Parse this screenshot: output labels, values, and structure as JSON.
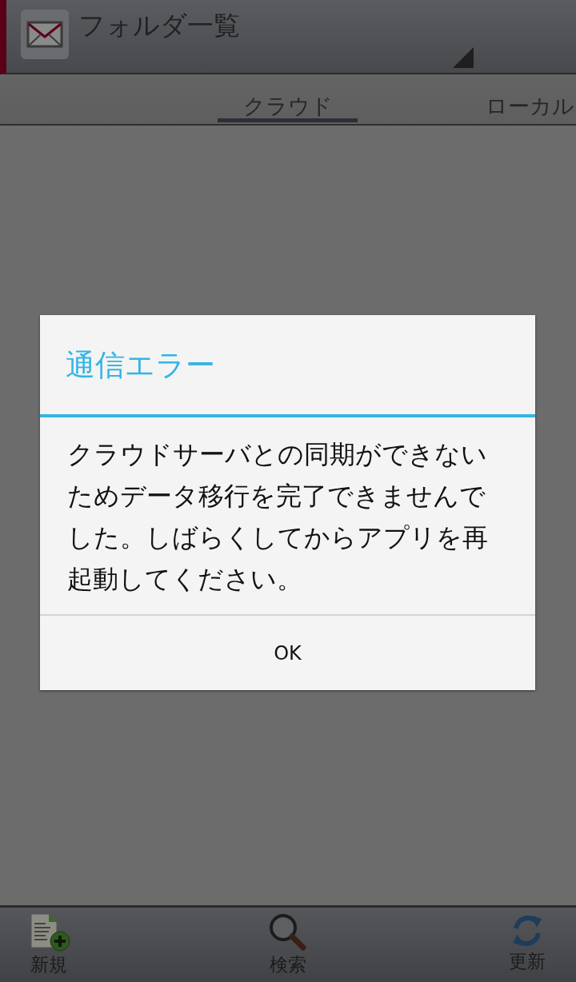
{
  "header": {
    "title": "フォルダ一覧"
  },
  "tabs": [
    {
      "label": "クラウド",
      "selected": true
    },
    {
      "label": "ローカル",
      "selected": false
    }
  ],
  "dialog": {
    "title": "通信エラー",
    "message": "クラウドサーバとの同期ができないためデータ移行を完了できませんでした。しばらくしてからアプリを再起動してください。",
    "button": "OK"
  },
  "toolbar": [
    {
      "kind": "new",
      "label": "新規"
    },
    {
      "kind": "search",
      "label": "検索"
    },
    {
      "kind": "refresh",
      "label": "更新"
    }
  ]
}
